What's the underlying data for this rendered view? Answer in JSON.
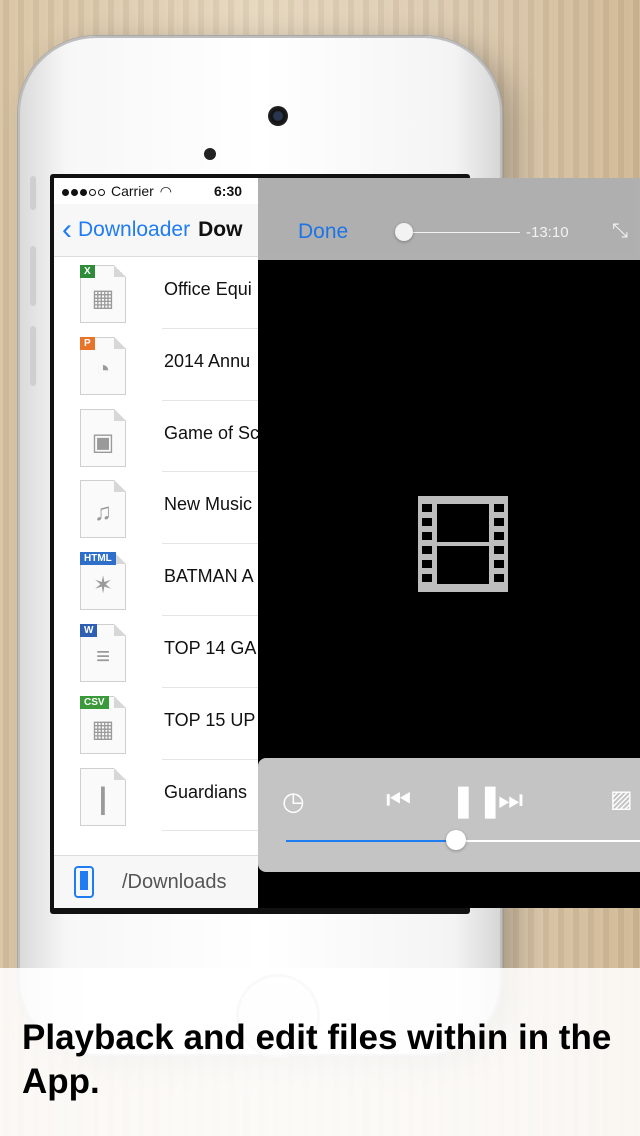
{
  "status": {
    "carrier": "Carrier",
    "time": "6:30"
  },
  "nav": {
    "back_label": "Downloader",
    "title": "Dow"
  },
  "files": [
    {
      "name": "Office Equi",
      "badge": "X",
      "badge_color": "#2e8b3a",
      "glyph": "▦"
    },
    {
      "name": "2014 Annu",
      "badge": "P",
      "badge_color": "#e8742a",
      "glyph": "◔"
    },
    {
      "name": "Game of Sc",
      "badge": "",
      "badge_color": "",
      "glyph": "▣"
    },
    {
      "name": "New Music",
      "badge": "",
      "badge_color": "",
      "glyph": "♫"
    },
    {
      "name": "BATMAN A",
      "badge": "HTML",
      "badge_color": "#2e6fc9",
      "glyph": "✶"
    },
    {
      "name": "TOP 14 GA",
      "badge": "W",
      "badge_color": "#2e5fb3",
      "glyph": "≡"
    },
    {
      "name": "TOP 15 UP",
      "badge": "CSV",
      "badge_color": "#3a9a3a",
      "glyph": "▦"
    },
    {
      "name": "Guardians",
      "badge": "",
      "badge_color": "",
      "glyph": "┃"
    }
  ],
  "bottom": {
    "path": "/Downloads"
  },
  "player": {
    "done_label": "Done",
    "remaining": "-13:10",
    "scrub_position": 0.05,
    "volume": 0.48
  },
  "caption": "Playback and edit files within in the App.",
  "colors": {
    "accent": "#1f7cf2"
  }
}
